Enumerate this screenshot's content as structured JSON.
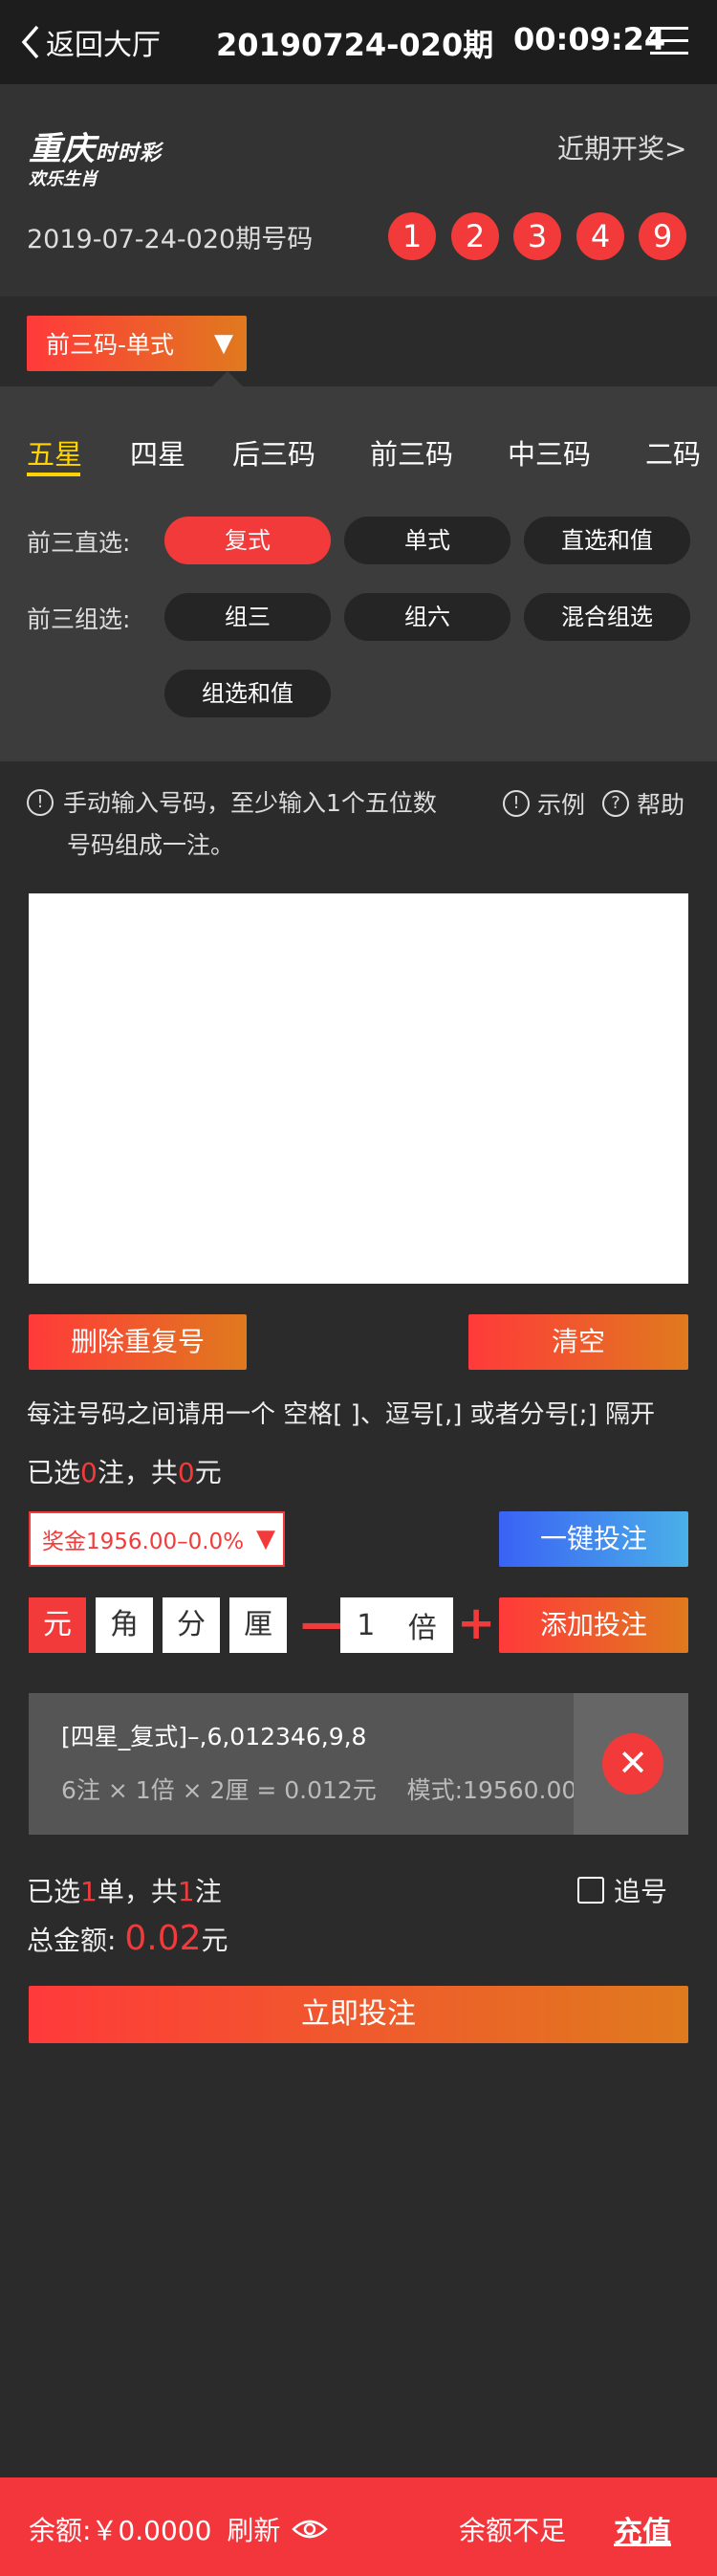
{
  "header": {
    "back_label": "返回大厅",
    "period": "20190724-020期",
    "timer": "00:09:24"
  },
  "lottery": {
    "logo_main": "重庆",
    "logo_small": "时时彩",
    "logo_sub": "欢乐生肖",
    "recent_label": "近期开奖>",
    "issue_label": "2019-07-24-020期号码",
    "balls": [
      "1",
      "2",
      "3",
      "4",
      "9"
    ]
  },
  "mode": {
    "label": "前三码-单式",
    "arrow": "▼"
  },
  "tabs": [
    "五星",
    "四星",
    "后三码",
    "前三码",
    "中三码",
    "二码"
  ],
  "options": {
    "direct_label": "前三直选:",
    "direct": [
      "复式",
      "单式",
      "直选和值"
    ],
    "group_label": "前三组选:",
    "group": [
      "组三",
      "组六",
      "混合组选",
      "组选和值"
    ]
  },
  "hint": {
    "line1": "手动输入号码，至少输入1个五位数",
    "line2": "号码组成一注。",
    "example": "示例",
    "help": "帮助"
  },
  "input": {
    "placeholder": ""
  },
  "actions": {
    "delete_dup": "删除重复号",
    "clear": "清空",
    "separator_text": "每注号码之间请用一个 空格[ ]、逗号[,] 或者分号[;] 隔开",
    "selected_prefix": "已选",
    "selected_count": "0",
    "selected_mid": "注，共",
    "selected_amount": "0",
    "selected_suffix": "元"
  },
  "prize": {
    "label": "奖金1956.00–0.0%",
    "arrow": "▼"
  },
  "onekey_label": "一键投注",
  "units": [
    "元",
    "角",
    "分",
    "厘"
  ],
  "multiplier": {
    "minus": "—",
    "value": "1",
    "unit": "倍",
    "plus": "+"
  },
  "add_bet_label": "添加投注",
  "bet": {
    "title": "[四星_复式]–,6,012346,9,8",
    "detail": "6注 × 1倍 × 2厘 = 0.012元",
    "mode": "模式:19560.00",
    "close": "✕"
  },
  "summary": {
    "line1_a": "已选",
    "orders": "1",
    "line1_b": "单，共",
    "bets": "1",
    "line1_c": "注",
    "chase_label": "追号",
    "total_label": "总金额:",
    "total_amount": "0.02",
    "total_unit": "元",
    "submit_label": "立即投注"
  },
  "footer": {
    "balance_label": "余额:￥0.0000",
    "refresh_label": "刷新",
    "insufficient": "余额不足",
    "recharge": "充值"
  },
  "colors": {
    "accent_red": "#f33a3a",
    "accent_orange": "#e07a1e",
    "tab_active": "#ffd400",
    "blue": "#3a62f5"
  }
}
